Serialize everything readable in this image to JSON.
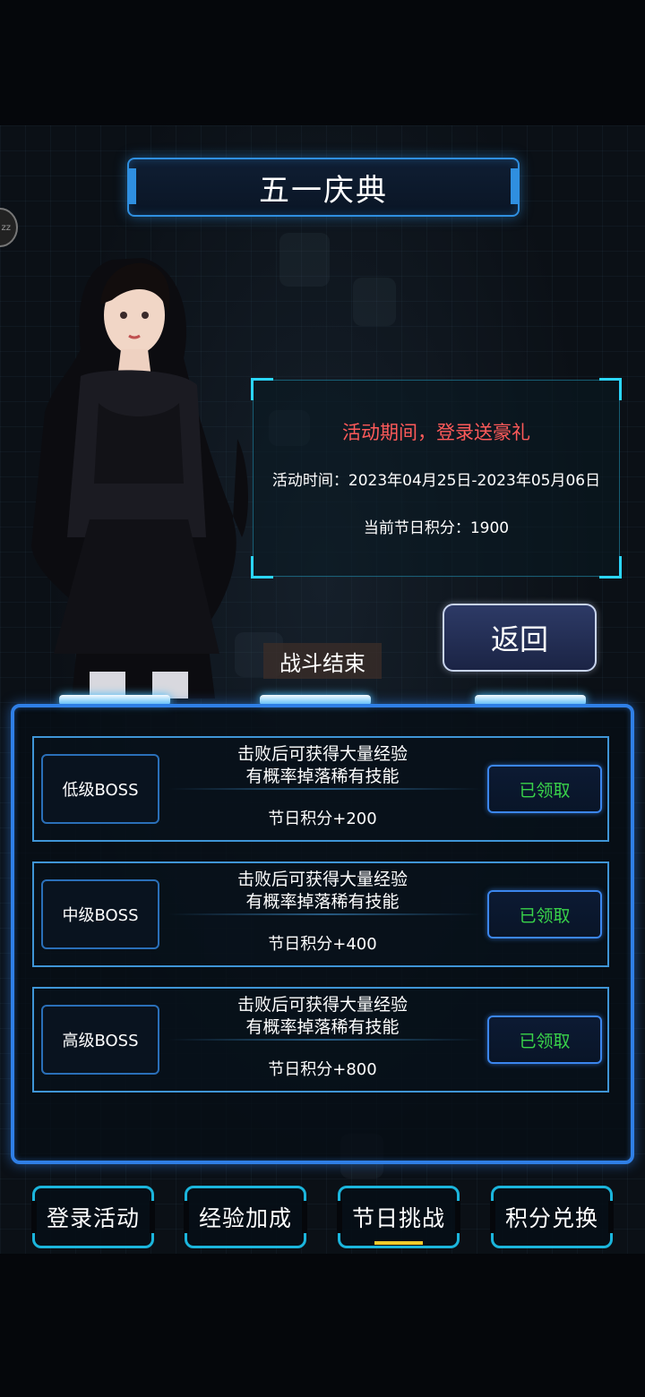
{
  "header": {
    "title": "五一庆典",
    "side_badge": "zz"
  },
  "info": {
    "headline": "活动期间，登录送豪礼",
    "date_text": "活动时间：2023年04月25日-2023年05月06日",
    "points_text": "当前节日积分：1900"
  },
  "actions": {
    "back_label": "返回"
  },
  "status": {
    "battle_over": "战斗结束"
  },
  "bosses": [
    {
      "name": "低级BOSS",
      "desc1": "击败后可获得大量经验",
      "desc2": "有概率掉落稀有技能",
      "points": "节日积分+200",
      "claim": "已领取"
    },
    {
      "name": "中级BOSS",
      "desc1": "击败后可获得大量经验",
      "desc2": "有概率掉落稀有技能",
      "points": "节日积分+400",
      "claim": "已领取"
    },
    {
      "name": "高级BOSS",
      "desc1": "击败后可获得大量经验",
      "desc2": "有概率掉落稀有技能",
      "points": "节日积分+800",
      "claim": "已领取"
    }
  ],
  "tabs": [
    {
      "label": "登录活动"
    },
    {
      "label": "经验加成"
    },
    {
      "label": "节日挑战",
      "active": true
    },
    {
      "label": "积分兑换"
    }
  ],
  "colors": {
    "accent": "#2f7fe6",
    "claimed": "#39d34a",
    "headline": "#ff5a5a",
    "active_tab": "#f1c92b"
  }
}
